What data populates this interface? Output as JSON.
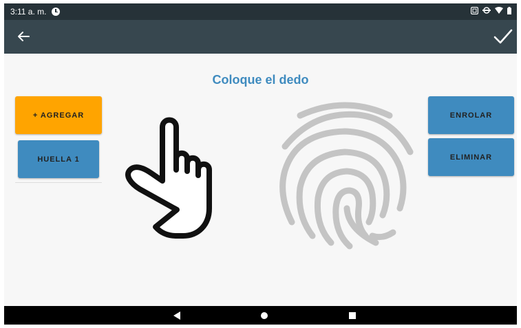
{
  "status_bar": {
    "time": "3:11 a. m."
  },
  "app_bar": {
    "back_icon": "arrow-left-icon",
    "confirm_icon": "check-icon"
  },
  "main": {
    "title": "Coloque el dedo",
    "add_button": "+ AGREGAR",
    "fingerprints": [
      {
        "label": "HUELLA 1"
      }
    ],
    "enroll_button": "ENROLAR",
    "delete_button": "ELIMINAR"
  },
  "colors": {
    "status_bar": "#263238",
    "app_bar": "#37474f",
    "accent_blue": "#3f8bbf",
    "accent_orange": "#ffa400"
  },
  "nav_bar": {
    "icons": [
      "back-triangle-icon",
      "home-circle-icon",
      "recents-square-icon"
    ]
  }
}
